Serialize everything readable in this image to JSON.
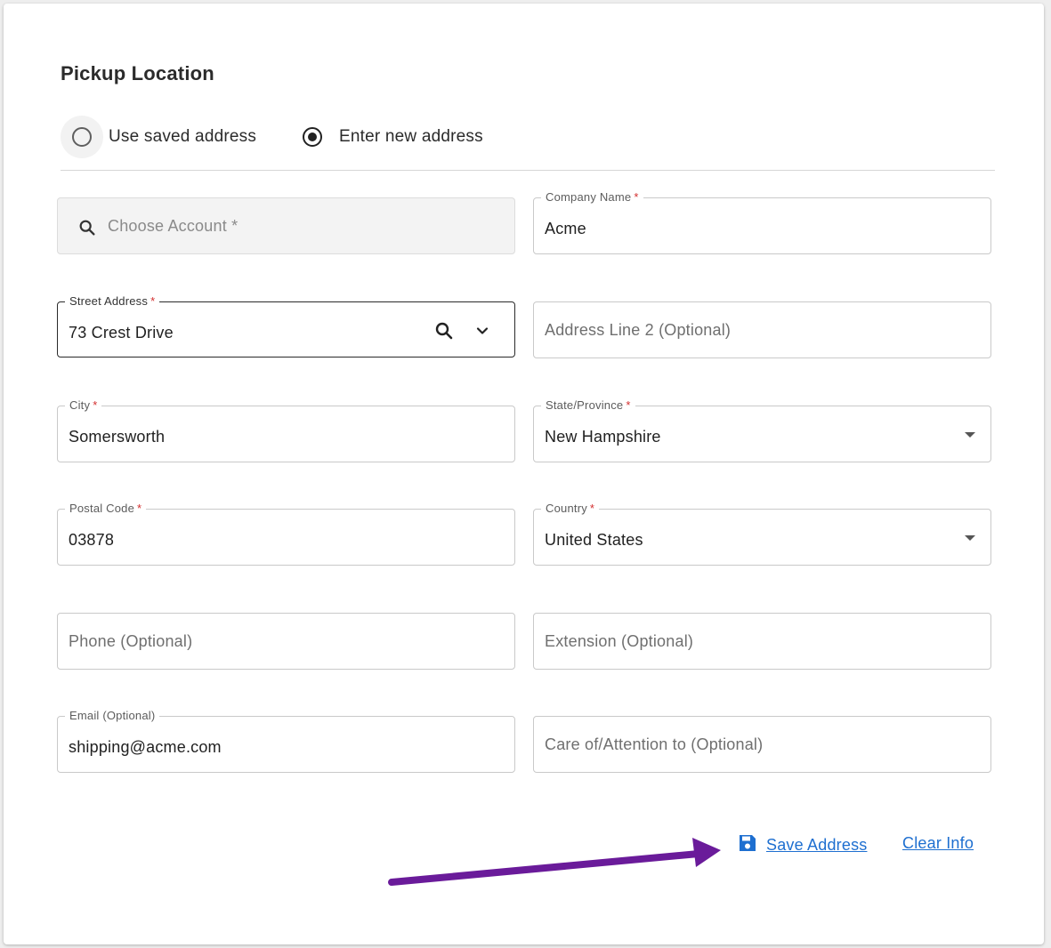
{
  "section": {
    "title": "Pickup Location"
  },
  "address_mode": {
    "options": [
      {
        "label": "Use saved address",
        "selected": false
      },
      {
        "label": "Enter new address",
        "selected": true
      }
    ]
  },
  "form": {
    "account": {
      "placeholder": "Choose Account *"
    },
    "company_name": {
      "label": "Company Name",
      "required_mark": "*",
      "value": "Acme"
    },
    "street_address": {
      "label": "Street Address",
      "required_mark": "*",
      "value": "73 Crest Drive"
    },
    "address_line_2": {
      "placeholder": "Address Line 2 (Optional)"
    },
    "city": {
      "label": "City",
      "required_mark": "*",
      "value": "Somersworth"
    },
    "state": {
      "label": "State/Province",
      "required_mark": "*",
      "value": "New Hampshire"
    },
    "postal_code": {
      "label": "Postal Code",
      "required_mark": "*",
      "value": "03878"
    },
    "country": {
      "label": "Country",
      "required_mark": "*",
      "value": "United States"
    },
    "phone": {
      "placeholder": "Phone (Optional)"
    },
    "extension": {
      "placeholder": "Extension (Optional)"
    },
    "email": {
      "label": "Email (Optional)",
      "value": "shipping@acme.com"
    },
    "care_of": {
      "placeholder": "Care of/Attention to (Optional)"
    }
  },
  "actions": {
    "save_label": "Save Address",
    "clear_label": "Clear Info"
  },
  "icons": {
    "save": "save-floppy-icon",
    "search": "search-icon",
    "chevron": "chevron-down-icon",
    "dropdown": "dropdown-caret-icon"
  },
  "colors": {
    "link": "#1e6fd0",
    "required": "#d32f2f",
    "annotation_arrow": "#6a1b9a"
  }
}
